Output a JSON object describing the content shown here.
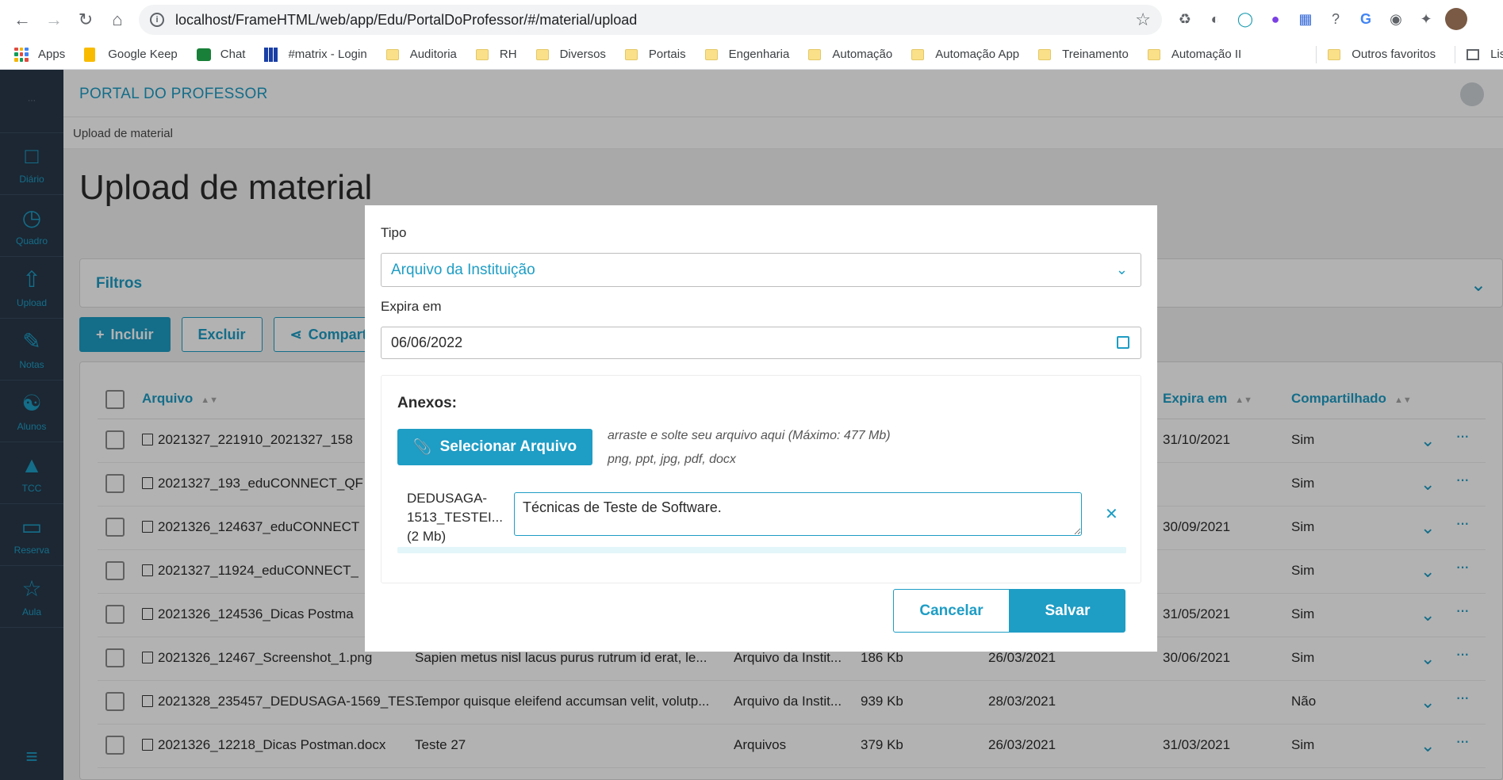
{
  "browser": {
    "url": "localhost/FrameHTML/web/app/Edu/PortalDoProfessor/#/material/upload",
    "bookmarks": [
      "Apps",
      "Google Keep",
      "Chat",
      "#matrix - Login",
      "Auditoria",
      "RH",
      "Diversos",
      "Portais",
      "Engenharia",
      "Automação",
      "Automação App",
      "Treinamento",
      "Automação II"
    ],
    "bookmarks_right": [
      "Outros favoritos",
      "Lista de leitur"
    ]
  },
  "app": {
    "title": "PORTAL DO PROFESSOR",
    "breadcrumb": "Upload de material",
    "page_title": "Upload de material"
  },
  "sidebar": {
    "items": [
      {
        "label": "Diário",
        "icon": "book-icon"
      },
      {
        "label": "Quadro",
        "icon": "clock-icon"
      },
      {
        "label": "Upload",
        "icon": "upload-icon"
      },
      {
        "label": "Notas",
        "icon": "pencil-icon"
      },
      {
        "label": "Alunos",
        "icon": "person-icon"
      },
      {
        "label": "TCC",
        "icon": "graduation-cap-icon"
      },
      {
        "label": "Reserva",
        "icon": "monitor-icon"
      },
      {
        "label": "Aula",
        "icon": "calendar-star-icon"
      }
    ]
  },
  "filters": {
    "label": "Filtros"
  },
  "actions": {
    "include": "Incluir",
    "delete": "Excluir",
    "share": "Compartil"
  },
  "table": {
    "headers": {
      "file": "Arquivo",
      "expires": "Expira em",
      "shared": "Compartilhado"
    },
    "rows": [
      {
        "file": "2021327_221910_2021327_158",
        "desc": "",
        "type": "",
        "size": "",
        "date": "",
        "expires": "31/10/2021",
        "shared": "Sim",
        "icon": "image"
      },
      {
        "file": "2021327_193_eduCONNECT_QF",
        "desc": "",
        "type": "",
        "size": "",
        "date": "",
        "expires": "",
        "shared": "Sim",
        "icon": "image"
      },
      {
        "file": "2021326_124637_eduCONNECT",
        "desc": "",
        "type": "",
        "size": "",
        "date": "",
        "expires": "30/09/2021",
        "shared": "Sim",
        "icon": "image"
      },
      {
        "file": "2021327_11924_eduCONNECT_",
        "desc": "",
        "type": "",
        "size": "",
        "date": "",
        "expires": "",
        "shared": "Sim",
        "icon": "image"
      },
      {
        "file": "2021326_124536_Dicas Postma",
        "desc": "",
        "type": "",
        "size": "",
        "date": "",
        "expires": "31/05/2021",
        "shared": "Sim",
        "icon": "doc"
      },
      {
        "file": "2021326_12467_Screenshot_1.png",
        "desc": "Sapien metus nisl lacus purus rutrum id erat, le...",
        "type": "Arquivo da Instit...",
        "size": "186 Kb",
        "date": "26/03/2021",
        "expires": "30/06/2021",
        "shared": "Sim",
        "icon": "image"
      },
      {
        "file": "2021328_235457_DEDUSAGA-1569_TES...",
        "desc": "Tempor quisque eleifend accumsan velit, volutp...",
        "type": "Arquivo da Instit...",
        "size": "939 Kb",
        "date": "28/03/2021",
        "expires": "",
        "shared": "Não",
        "icon": "doc"
      },
      {
        "file": "2021326_12218_Dicas Postman.docx",
        "desc": "Teste 27",
        "type": "Arquivos",
        "size": "379 Kb",
        "date": "26/03/2021",
        "expires": "31/03/2021",
        "shared": "Sim",
        "icon": "doc"
      }
    ]
  },
  "modal": {
    "type_label": "Tipo",
    "type_value": "Arquivo da Instituição",
    "expires_label": "Expira em",
    "expires_value": "06/06/2022",
    "attachments_label": "Anexos:",
    "select_file": "Selecionar Arquivo",
    "drop_hint": "arraste e solte seu arquivo aqui (Máximo: 477 Mb)",
    "formats_hint": "png, ppt, jpg, pdf, docx",
    "file_name_line1": "DEDUSAGA-",
    "file_name_line2": "1513_TESTEI...",
    "file_size": "(2 Mb)",
    "description": "Técnicas de Teste de Software.",
    "cancel": "Cancelar",
    "save": "Salvar"
  },
  "colors": {
    "accent": "#1e9dc5",
    "sidebar": "#29394a"
  }
}
